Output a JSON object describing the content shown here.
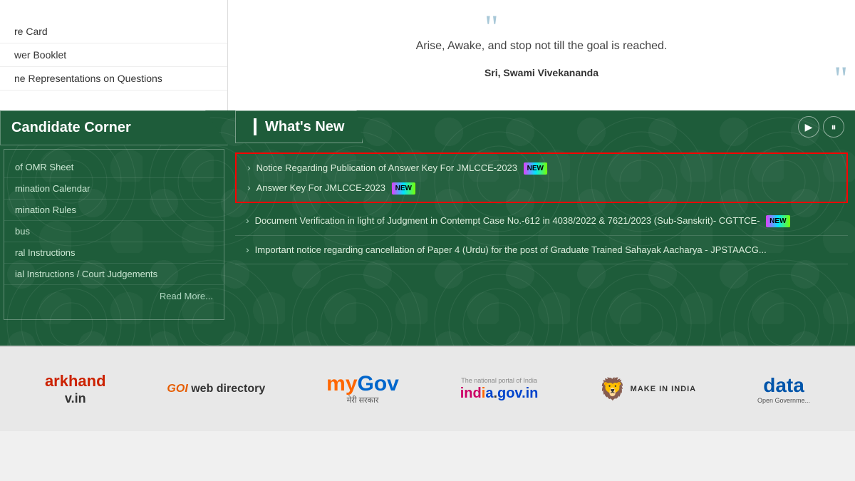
{
  "top": {
    "menu_items": [
      {
        "label": "re Card"
      },
      {
        "label": "wer Booklet"
      },
      {
        "label": "ne Representations on Questions"
      }
    ],
    "quote": "Arise, Awake, and stop not till the goal is reached.",
    "quote_author": "Sri, Swami Vivekananda"
  },
  "candidate_corner": {
    "title": "Candidate Corner",
    "items": [
      {
        "label": "of OMR Sheet"
      },
      {
        "label": "mination Calendar"
      },
      {
        "label": "mination Rules"
      },
      {
        "label": "bus"
      },
      {
        "label": "ral Instructions"
      },
      {
        "label": "ial Instructions / Court Judgements"
      }
    ],
    "read_more": "Read More..."
  },
  "whats_new": {
    "title": "What's New",
    "play_label": "▶",
    "pause_label": "⏸",
    "news_items": [
      {
        "text": "Notice Regarding Publication of Answer Key For JMLCCE-2023",
        "badge": "NEW",
        "highlighted": true
      },
      {
        "text": "Answer Key For JMLCCE-2023",
        "badge": "NEW",
        "highlighted": true
      },
      {
        "text": "Document Verification in light of Judgment in Contempt Case No.-612 in 4038/2022 & 7621/2023 (Sub-Sanskrit)- CGTTCE-",
        "badge": "NEW",
        "highlighted": false
      },
      {
        "text": "Important notice regarding cancellation of Paper 4 (Urdu) for the post of Graduate Trained Sahayak Aacharya - JPSTAACG...",
        "badge": "",
        "highlighted": false
      }
    ]
  },
  "footer": {
    "logos": [
      {
        "name": "jharkhand",
        "line1": "arkhand",
        "line2": "v.in"
      },
      {
        "name": "goi-web-directory",
        "text": "GOI web directory"
      },
      {
        "name": "mygov",
        "text": "myGov",
        "subtext": "मेरी सरकार"
      },
      {
        "name": "india-gov",
        "text": "india.gov.in",
        "subtext": "The national portal of India"
      },
      {
        "name": "make-in-india",
        "text": "MAKE IN INDIA"
      },
      {
        "name": "data-gov",
        "text": "data",
        "subtext": "Open Governme..."
      }
    ]
  }
}
